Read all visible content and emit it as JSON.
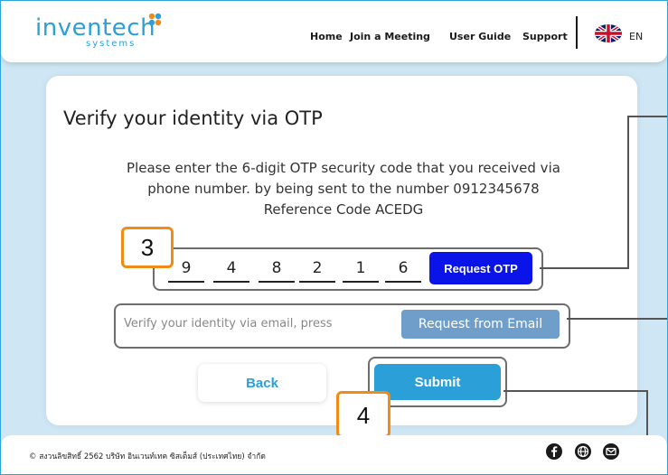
{
  "brand": {
    "name_part1": "inven",
    "name_part2": "tech",
    "sub": "systems"
  },
  "nav": {
    "home": "Home",
    "join": "Join a Meeting",
    "guide": "User Guide",
    "support": "Support",
    "lang": "EN"
  },
  "card": {
    "title": "Verify your identity via OTP",
    "instruction_line1": "Please enter the 6-digit OTP security code that you received via",
    "instruction_line2": "phone number. by being sent to the number 0912345678",
    "reference": "Reference Code ACEDG"
  },
  "otp": {
    "digits": [
      "9",
      "4",
      "8",
      "2",
      "1",
      "6"
    ],
    "request_label": "Request OTP"
  },
  "email": {
    "label": "Verify your identity via email, press",
    "request_label": "Request from Email"
  },
  "actions": {
    "back_label": "Back",
    "submit_label": "Submit"
  },
  "badges": {
    "step3": "3",
    "step4": "4"
  },
  "footer": {
    "copyright": "© สงวนลิขสิทธิ์ 2562 บริษัท อินเวนท์เทค ซิสเต็มส์ (ประเทศไทย) จำกัด"
  },
  "icons": {
    "facebook": "facebook-icon",
    "globe": "globe-icon",
    "mail": "mail-icon",
    "flag": "uk-flag-icon"
  },
  "colors": {
    "accent": "#2a9fd8",
    "otp_button": "#0a14e8",
    "email_button": "#6f9ecb",
    "badge_border": "#f08b18"
  }
}
